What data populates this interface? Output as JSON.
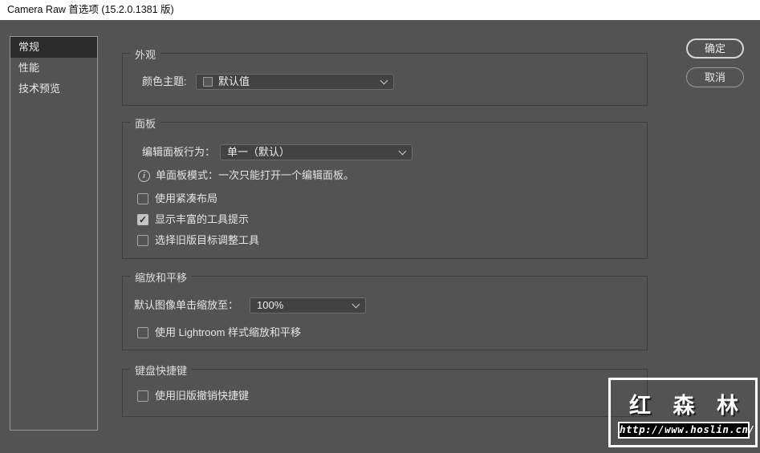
{
  "title_bar": {
    "title": "Camera Raw 首选项  (15.2.0.1381 版)"
  },
  "sidebar": {
    "items": [
      {
        "label": "常规",
        "selected": true
      },
      {
        "label": "性能",
        "selected": false
      },
      {
        "label": "技术预览",
        "selected": false
      }
    ]
  },
  "buttons": {
    "ok": "确定",
    "cancel": "取消"
  },
  "sections": {
    "appearance": {
      "title": "外观",
      "color_theme_label": "颜色主题:",
      "color_theme_value": "默认值"
    },
    "panels": {
      "title": "面板",
      "edit_panel_behavior_label": "编辑面板行为：",
      "edit_panel_behavior_value": "单一（默认）",
      "info_text": "单面板模式：一次只能打开一个编辑面板。",
      "checkboxes": [
        {
          "label": "使用紧凑布局",
          "checked": false
        },
        {
          "label": "显示丰富的工具提示",
          "checked": true
        },
        {
          "label": "选择旧版目标调整工具",
          "checked": false
        }
      ]
    },
    "zoom_pan": {
      "title": "缩放和平移",
      "default_zoom_label": "默认图像单击缩放至：",
      "default_zoom_value": "100%",
      "checkbox": {
        "label": "使用 Lightroom 样式缩放和平移",
        "checked": false
      }
    },
    "keyboard": {
      "title": "键盘快捷键",
      "checkbox": {
        "label": "使用旧版撤销快捷键",
        "checked": false
      }
    }
  },
  "watermark": {
    "name": "红 森 林",
    "url": "http://www.hoslin.cn/"
  },
  "icons": {
    "checkmark": "✓",
    "info": "i"
  },
  "colors": {
    "titlebar_bg": "#ffffff",
    "dialog_bg": "#535353",
    "selected_item_bg": "#2b2b2b",
    "fieldset_border": "#3e3e3e",
    "watermark_border": "#ffffff"
  }
}
